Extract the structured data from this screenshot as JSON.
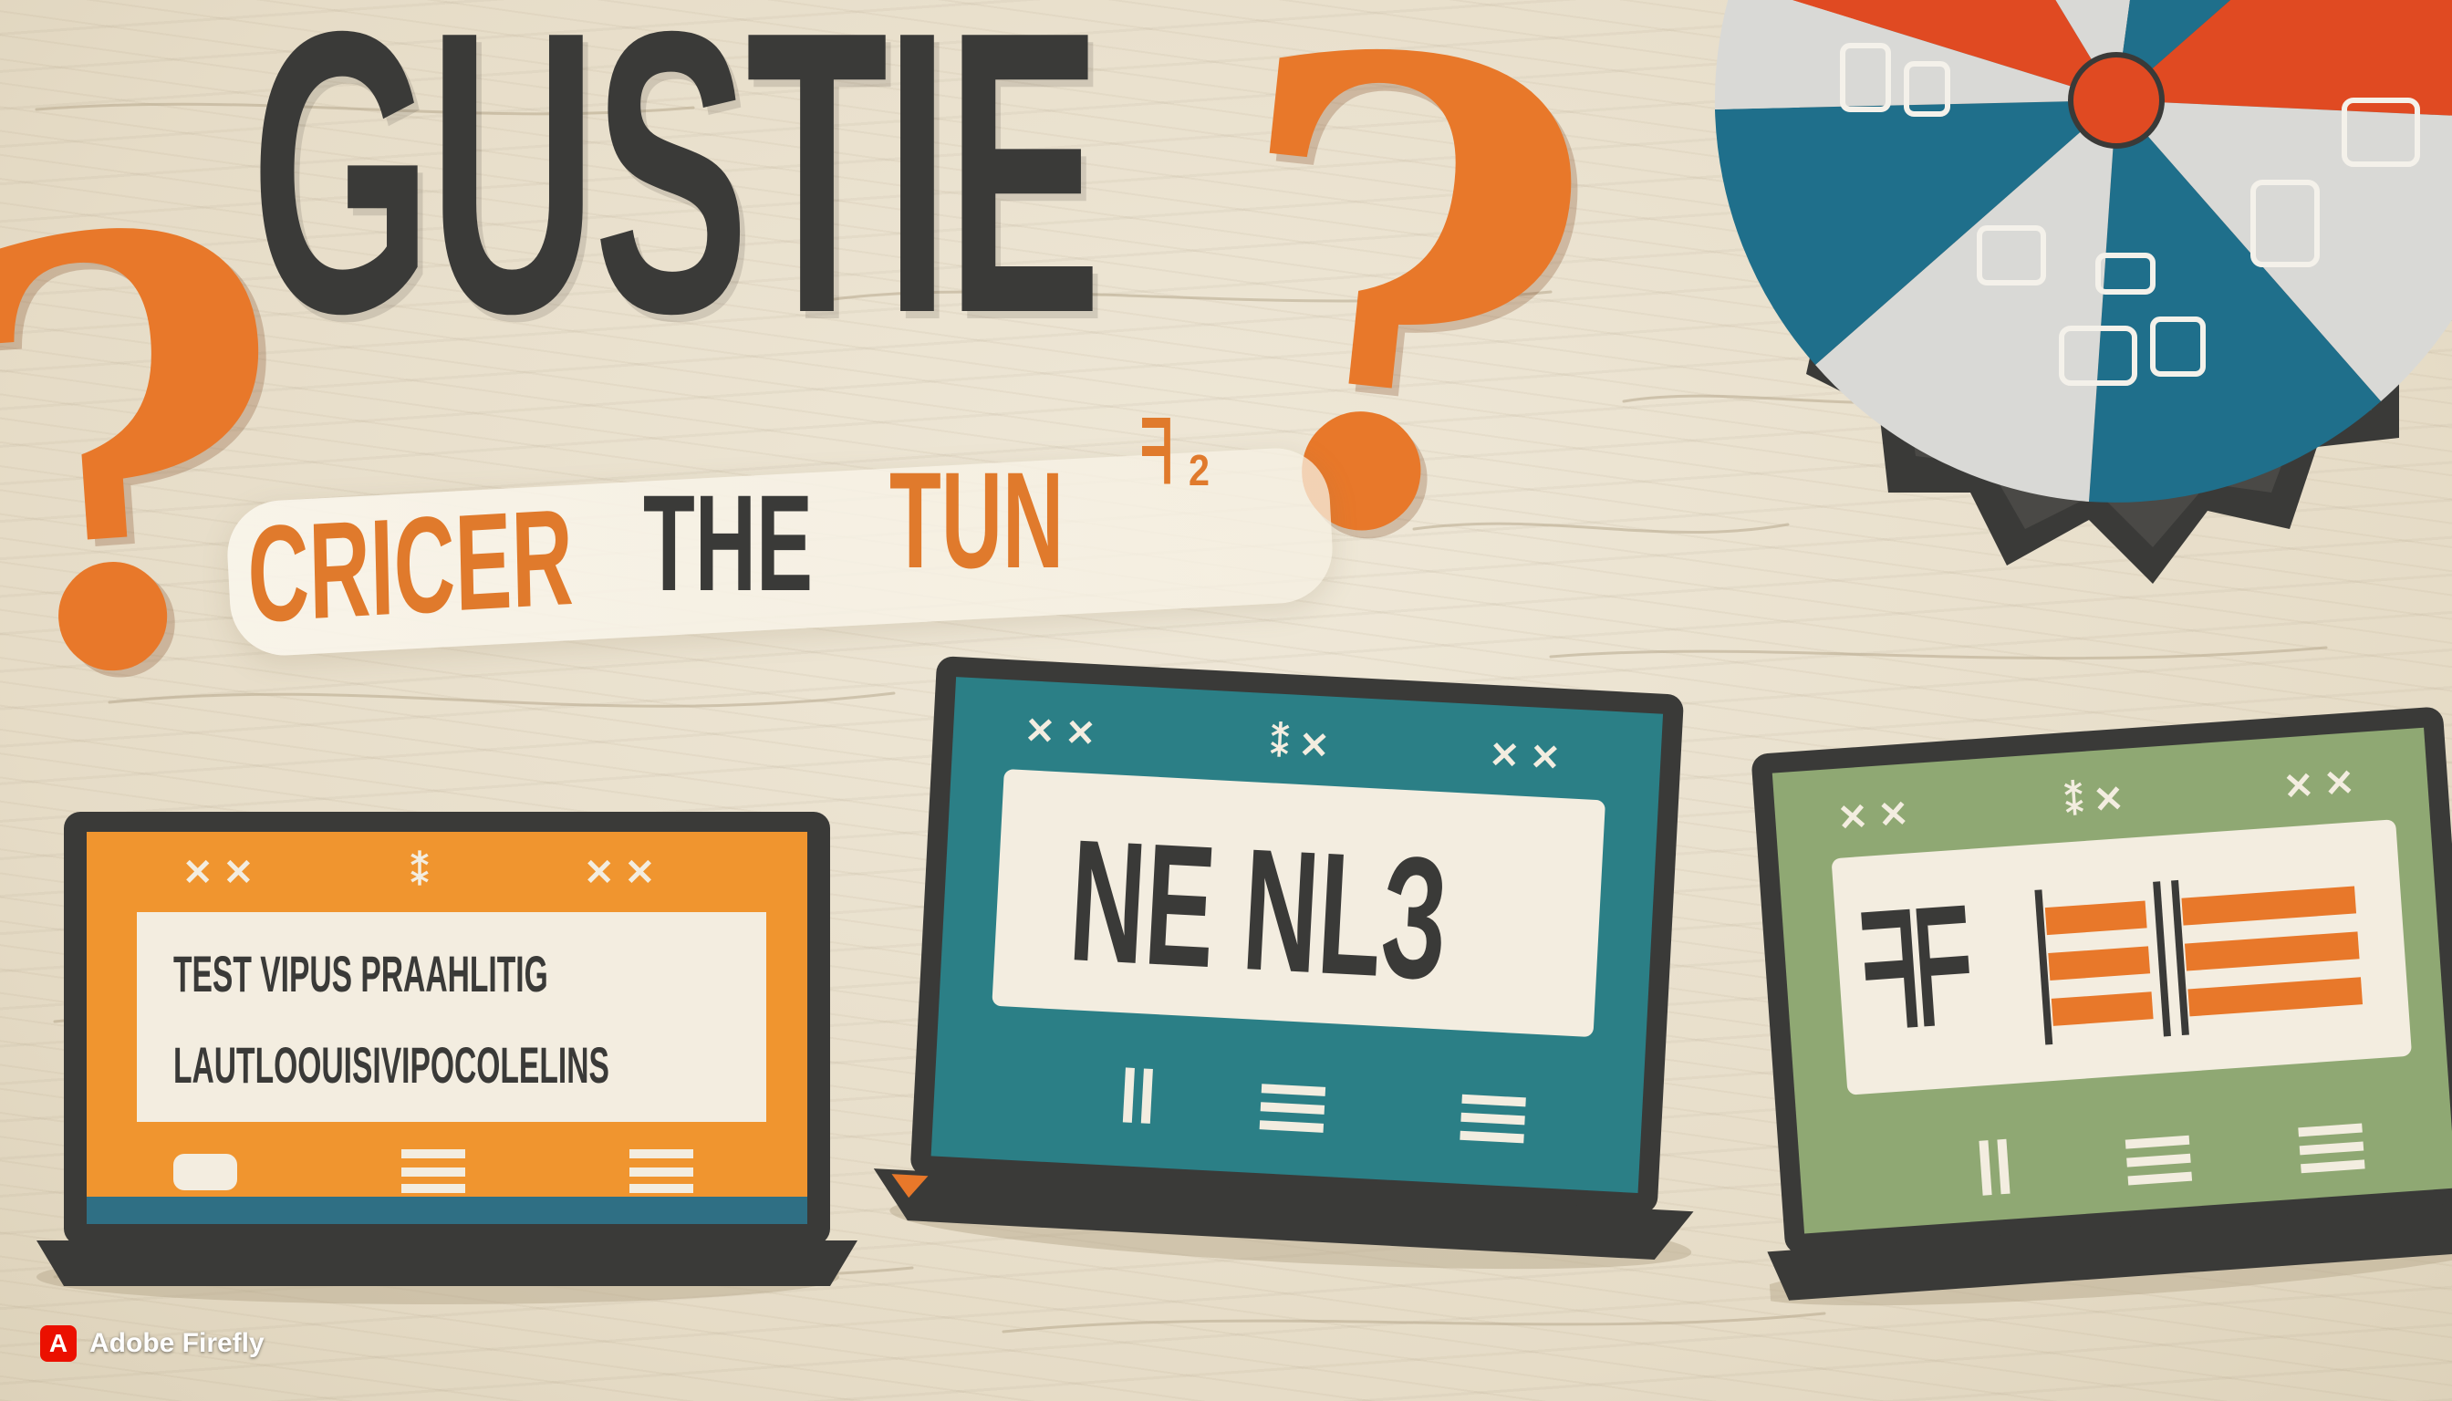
{
  "headline": {
    "title": "GUSTIE",
    "question_mark": "?"
  },
  "subtitle": {
    "word1": "CRICER",
    "word2": "THE",
    "word3": "TUN",
    "glyph": "ᖷ ₂"
  },
  "wheel": {
    "colors": [
      "#e04a22",
      "#1f6f8b",
      "#d9d9d6"
    ],
    "hub_color": "#e04a22",
    "rim_color": "#3a3a38"
  },
  "laptops": [
    {
      "color": "#f0952f",
      "line1": "TEST VIPUS  PRAAHLITIG",
      "line2": "LAUTLOOUISIVIPOCOLELINS"
    },
    {
      "color": "#2b7f86",
      "line1": "NE NLЗ"
    },
    {
      "color": "#8fa873",
      "line1": "ᖷᖴ"
    }
  ],
  "watermark": {
    "logo_glyph": "A",
    "text": "Adobe Firefly"
  }
}
